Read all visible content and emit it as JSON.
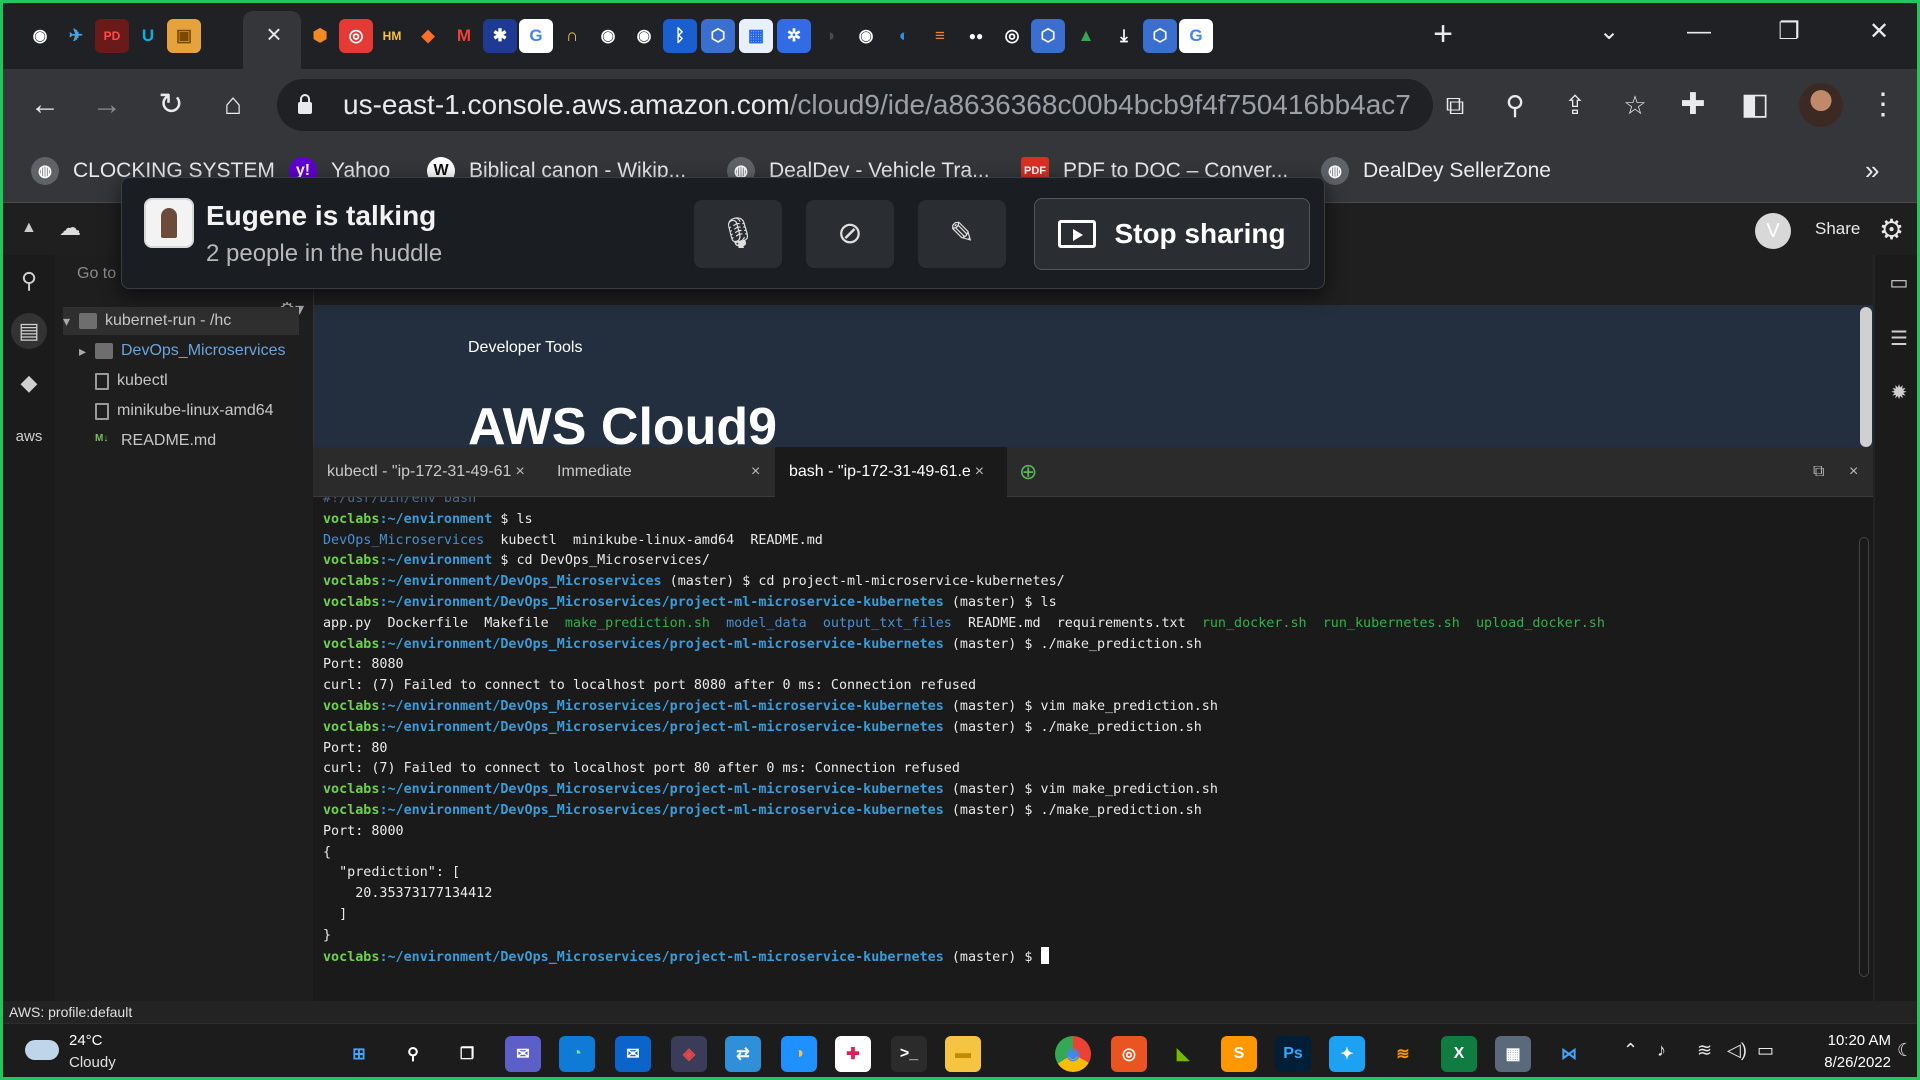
{
  "browser": {
    "tab_icons": [
      {
        "name": "github-icon",
        "glyph": "◉",
        "bg": "#202124",
        "fg": "#ffffff"
      },
      {
        "name": "bird-app-icon",
        "glyph": "✈",
        "bg": "#202124",
        "fg": "#4aa3df"
      },
      {
        "name": "pdf-icon",
        "glyph": "PD",
        "bg": "#6b1a1a",
        "fg": "#ff4d4d"
      },
      {
        "name": "udacity-icon",
        "glyph": "U",
        "bg": "#202124",
        "fg": "#02b3e4"
      },
      {
        "name": "box-icon",
        "glyph": "▣",
        "bg": "#e6a23c",
        "fg": "#7a4a00"
      },
      {
        "name": "aws-box-icon",
        "glyph": "⬢",
        "bg": "#202124",
        "fg": "#f08a24"
      },
      {
        "name": "red-circle-icon",
        "glyph": "◎",
        "bg": "#e53935",
        "fg": "#ffffff"
      },
      {
        "name": "harvey-mudd-icon",
        "glyph": "HM",
        "bg": "#202124",
        "fg": "#f6c344"
      },
      {
        "name": "gitlab-icon",
        "glyph": "◆",
        "bg": "#202124",
        "fg": "#fc6d26"
      },
      {
        "name": "gmail-icon",
        "glyph": "M",
        "bg": "#202124",
        "fg": "#ea4335"
      },
      {
        "name": "flag-icon",
        "glyph": "✱",
        "bg": "#1f3a93",
        "fg": "#ffffff"
      },
      {
        "name": "google-icon",
        "glyph": "G",
        "bg": "#ffffff",
        "fg": "#4285f4"
      },
      {
        "name": "headphones-icon",
        "glyph": "∩",
        "bg": "#202124",
        "fg": "#f9c846"
      },
      {
        "name": "github-icon",
        "glyph": "◉",
        "bg": "#202124",
        "fg": "#ffffff"
      },
      {
        "name": "github-icon",
        "glyph": "◉",
        "bg": "#202124",
        "fg": "#ffffff"
      },
      {
        "name": "bluetooth-icon",
        "glyph": "ᛒ",
        "bg": "#1a5fd0",
        "fg": "#ffffff"
      },
      {
        "name": "hex-icon",
        "glyph": "⬡",
        "bg": "#3a6fd0",
        "fg": "#ffffff"
      },
      {
        "name": "docker-icon",
        "glyph": "▦",
        "bg": "#e8f1fb",
        "fg": "#1d63ed"
      },
      {
        "name": "kubernetes-icon",
        "glyph": "✲",
        "bg": "#326ce5",
        "fg": "#ffffff"
      },
      {
        "name": "bird-icon",
        "glyph": "◑",
        "bg": "#202124",
        "fg": "#4a4a4a"
      },
      {
        "name": "github-icon",
        "glyph": "◉",
        "bg": "#202124",
        "fg": "#ffffff"
      },
      {
        "name": "docker-whale-icon",
        "glyph": "◐",
        "bg": "#202124",
        "fg": "#2496ed"
      },
      {
        "name": "stackoverflow-icon",
        "glyph": "≡",
        "bg": "#202124",
        "fg": "#f48024"
      },
      {
        "name": "medium-icon",
        "glyph": "●●",
        "bg": "#202124",
        "fg": "#ffffff"
      },
      {
        "name": "circle-target-icon",
        "glyph": "◎",
        "bg": "#202124",
        "fg": "#ffffff"
      },
      {
        "name": "hex-icon",
        "glyph": "⬡",
        "bg": "#3a6fd0",
        "fg": "#ffffff"
      },
      {
        "name": "google-drive-icon",
        "glyph": "▲",
        "bg": "#202124",
        "fg": "#34a853"
      },
      {
        "name": "download-icon",
        "glyph": "⤓",
        "bg": "#202124",
        "fg": "#ffffff"
      },
      {
        "name": "hex-icon",
        "glyph": "⬡",
        "bg": "#3a6fd0",
        "fg": "#ffffff"
      },
      {
        "name": "google-icon",
        "glyph": "G",
        "bg": "#ffffff",
        "fg": "#4285f4"
      }
    ],
    "active_tab_close": "×",
    "new_tab": "+",
    "url_host": "us-east-1.console.aws.amazon.com",
    "url_path": "/cloud9/ide/a8636368c00b4bcb9f4f750416bb4ac7",
    "bookmarks": [
      {
        "label": "CLOCKING SYSTEM",
        "icon": "globe-icon",
        "glyph": "◍",
        "bg": "#5f6368"
      },
      {
        "label": "Yahoo",
        "icon": "yahoo-icon",
        "glyph": "y!",
        "bg": "#6001d2"
      },
      {
        "label": "Biblical canon - Wikip...",
        "icon": "wikipedia-icon",
        "glyph": "W",
        "bg": "#ffffff"
      },
      {
        "label": "DealDev - Vehicle Tra...",
        "icon": "globe-icon",
        "glyph": "◍",
        "bg": "#5f6368"
      },
      {
        "label": "PDF to DOC – Conver...",
        "icon": "pdf-icon",
        "glyph": "PDF",
        "bg": "#d93025"
      },
      {
        "label": "DealDey SellerZone",
        "icon": "globe-icon",
        "glyph": "◍",
        "bg": "#5f6368"
      }
    ],
    "bookmarks_more": "»"
  },
  "huddle": {
    "title": "Eugene is talking",
    "subtitle": "2 people in the huddle",
    "stop_sharing_label": "Stop sharing"
  },
  "ide": {
    "goto_placeholder": "Go to",
    "tree": [
      {
        "label": "kubernet-run - /hc",
        "type": "root"
      },
      {
        "label": "DevOps_Microservices",
        "type": "folder"
      },
      {
        "label": "kubectl",
        "type": "file"
      },
      {
        "label": "minikube-linux-amd64",
        "type": "file"
      },
      {
        "label": "README.md",
        "type": "md"
      }
    ],
    "user_initial": "V",
    "share_label": "Share",
    "sidebar_label": "aws",
    "editor": {
      "subtitle": "Developer Tools",
      "title": "AWS Cloud9"
    },
    "terminal_tabs": [
      {
        "label": "kubectl - \"ip-172-31-49-61",
        "close": "×"
      },
      {
        "label": "Immediate",
        "close": "×"
      },
      {
        "label": "bash - \"ip-172-31-49-61.e",
        "close": "×"
      }
    ],
    "status": "AWS: profile:default"
  },
  "terminal": {
    "user": "voclabs",
    "lines": [
      {
        "kind": "plain",
        "text": "#!/usr/bin/env bash"
      },
      {
        "kind": "prompt",
        "path": ":~/environment",
        "branch": "",
        "cmd": " $ ls"
      },
      {
        "kind": "ls1",
        "items": [
          "DevOps_Microservices",
          "kubectl",
          "minikube-linux-amd64",
          "README.md"
        ]
      },
      {
        "kind": "prompt",
        "path": ":~/environment",
        "branch": "",
        "cmd": " $ cd DevOps_Microservices/"
      },
      {
        "kind": "prompt",
        "path": ":~/environment/DevOps_Microservices",
        "branch": " (master)",
        "cmd": " $ cd project-ml-microservice-kubernetes/"
      },
      {
        "kind": "prompt",
        "path": ":~/environment/DevOps_Microservices/project-ml-microservice-kubernetes",
        "branch": " (master)",
        "cmd": " $ ls"
      },
      {
        "kind": "ls2",
        "items": [
          "app.py",
          "Dockerfile",
          "Makefile",
          "make_prediction.sh",
          "model_data",
          "output_txt_files",
          "README.md",
          "requirements.txt",
          "run_docker.sh",
          "run_kubernetes.sh",
          "upload_docker.sh"
        ]
      },
      {
        "kind": "prompt",
        "path": ":~/environment/DevOps_Microservices/project-ml-microservice-kubernetes",
        "branch": " (master)",
        "cmd": " $ ./make_prediction.sh"
      },
      {
        "kind": "plain",
        "text": "Port: 8080"
      },
      {
        "kind": "plain",
        "text": "curl: (7) Failed to connect to localhost port 8080 after 0 ms: Connection refused"
      },
      {
        "kind": "prompt",
        "path": ":~/environment/DevOps_Microservices/project-ml-microservice-kubernetes",
        "branch": " (master)",
        "cmd": " $ vim make_prediction.sh"
      },
      {
        "kind": "prompt",
        "path": ":~/environment/DevOps_Microservices/project-ml-microservice-kubernetes",
        "branch": " (master)",
        "cmd": " $ ./make_prediction.sh"
      },
      {
        "kind": "plain",
        "text": "Port: 80"
      },
      {
        "kind": "plain",
        "text": "curl: (7) Failed to connect to localhost port 80 after 0 ms: Connection refused"
      },
      {
        "kind": "prompt",
        "path": ":~/environment/DevOps_Microservices/project-ml-microservice-kubernetes",
        "branch": " (master)",
        "cmd": " $ vim make_prediction.sh"
      },
      {
        "kind": "prompt",
        "path": ":~/environment/DevOps_Microservices/project-ml-microservice-kubernetes",
        "branch": " (master)",
        "cmd": " $ ./make_prediction.sh"
      },
      {
        "kind": "plain",
        "text": "Port: 8000"
      },
      {
        "kind": "plain",
        "text": "{"
      },
      {
        "kind": "plain",
        "text": "  \"prediction\": ["
      },
      {
        "kind": "plain",
        "text": "    20.35373177134412"
      },
      {
        "kind": "plain",
        "text": "  ]"
      },
      {
        "kind": "plain",
        "text": "}"
      },
      {
        "kind": "prompt_cursor",
        "path": ":~/environment/DevOps_Microservices/project-ml-microservice-kubernetes",
        "branch": " (master)",
        "cmd": " $ "
      }
    ]
  },
  "taskbar": {
    "temperature": "24°C",
    "weather": "Cloudy",
    "apps": [
      {
        "name": "start-icon",
        "glyph": "⊞",
        "bg": "#1c1c1c",
        "fg": "#3ea6ff"
      },
      {
        "name": "search-icon",
        "glyph": "⚲",
        "bg": "#1c1c1c",
        "fg": "#ffffff"
      },
      {
        "name": "task-view-icon",
        "glyph": "❐",
        "bg": "#1c1c1c",
        "fg": "#ffffff"
      },
      {
        "name": "teams-chat-icon",
        "glyph": "✉",
        "bg": "#5b5fc7",
        "fg": "#ffffff"
      },
      {
        "name": "edge-icon",
        "glyph": "◔",
        "bg": "#0f7bd6",
        "fg": "#7ee0a4"
      },
      {
        "name": "mail-icon",
        "glyph": "✉",
        "bg": "#0a64c9",
        "fg": "#ffffff"
      },
      {
        "name": "shield-app-icon",
        "glyph": "◈",
        "bg": "#3b3b5a",
        "fg": "#e04a4a"
      },
      {
        "name": "remote-desktop-icon",
        "glyph": "⇄",
        "bg": "#2f8fd8",
        "fg": "#ffffff"
      },
      {
        "name": "notification-app-icon",
        "glyph": "◑",
        "bg": "#1e90ff",
        "fg": "#f7c34b"
      },
      {
        "name": "slack-icon",
        "glyph": "✚",
        "bg": "#ffffff",
        "fg": "#e01e5a"
      },
      {
        "name": "terminal-icon",
        "glyph": ">_",
        "bg": "#2b2b2b",
        "fg": "#ffffff"
      },
      {
        "name": "file-explorer-icon",
        "glyph": "▬",
        "bg": "#f5c542",
        "fg": "#c48a00"
      },
      {
        "name": "chrome-icon",
        "glyph": "◉",
        "bg": "#1c1c1c",
        "fg": "#ea4335"
      },
      {
        "name": "ubuntu-icon",
        "glyph": "◎",
        "bg": "#e95420",
        "fg": "#ffffff"
      },
      {
        "name": "nvidia-icon",
        "glyph": "◣",
        "bg": "#1c1c1c",
        "fg": "#76b900"
      },
      {
        "name": "sublime-icon",
        "glyph": "S",
        "bg": "#ff9800",
        "fg": "#ffffff"
      },
      {
        "name": "photoshop-icon",
        "glyph": "Ps",
        "bg": "#001e36",
        "fg": "#31a8ff"
      },
      {
        "name": "twitter-icon",
        "glyph": "✦",
        "bg": "#1da1f2",
        "fg": "#ffffff"
      },
      {
        "name": "sublime-text-icon",
        "glyph": "≋",
        "bg": "#1c1c1c",
        "fg": "#ff9800"
      },
      {
        "name": "excel-icon",
        "glyph": "X",
        "bg": "#107c41",
        "fg": "#ffffff"
      },
      {
        "name": "calculator-icon",
        "glyph": "▦",
        "bg": "#5a6a7a",
        "fg": "#ffffff"
      },
      {
        "name": "vscode-icon",
        "glyph": "⋈",
        "bg": "#1c1c1c",
        "fg": "#3ea6ff"
      }
    ],
    "time": "10:20 AM",
    "date": "8/26/2022"
  }
}
